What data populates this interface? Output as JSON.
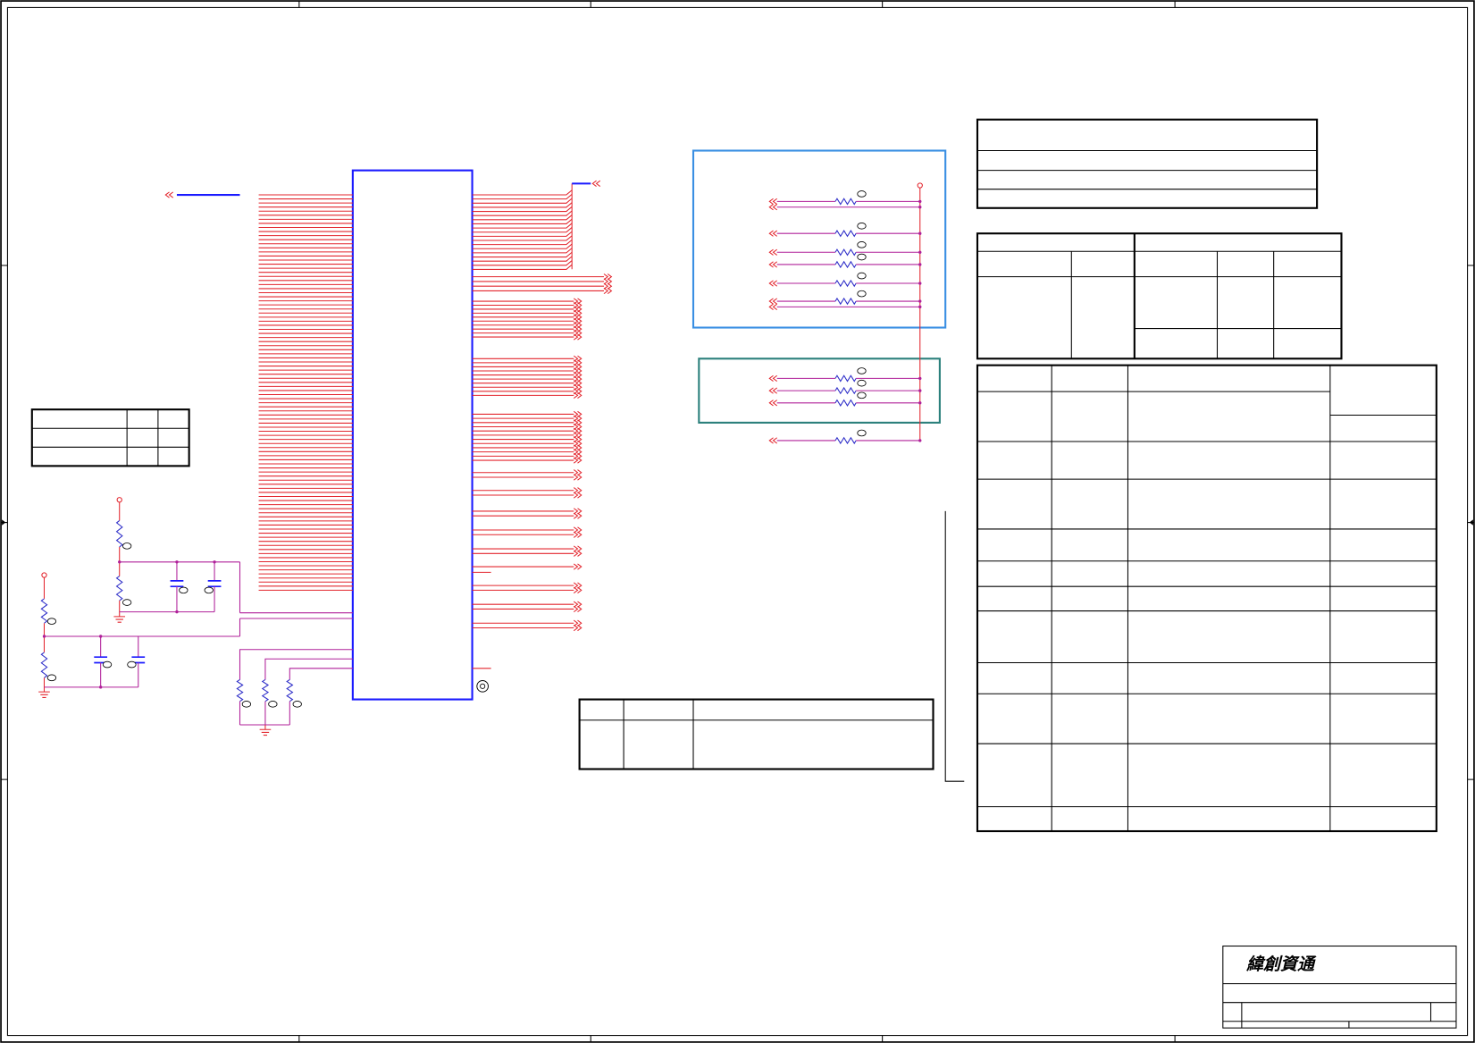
{
  "title_block": {
    "company": "緯創資通"
  },
  "colors": {
    "frame": "#000000",
    "wire": "#e3262e",
    "net": "#b0209a",
    "component": "#1a1aff",
    "resistor": "#2c2cc8",
    "group_box_primary": "#3a8fe3",
    "group_box_secondary": "#2b807c"
  }
}
